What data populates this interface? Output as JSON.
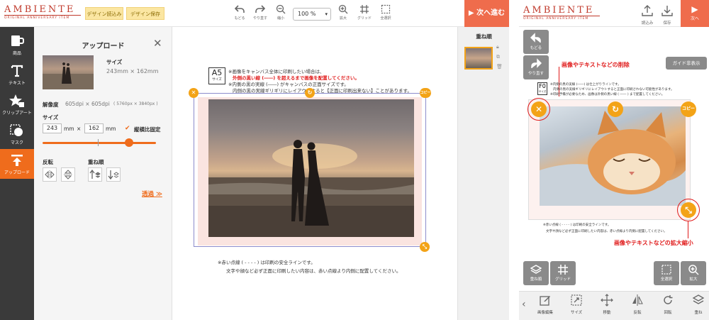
{
  "left": {
    "logo": {
      "main": "AMBIENTE",
      "sub": "ORIGINAL ANNIVERSARY ITEM"
    },
    "header_buttons": {
      "load": "デザイン読込み",
      "save": "デザイン保存"
    },
    "tools": [
      {
        "label": "もどる",
        "icon": "undo-icon"
      },
      {
        "label": "やり直す",
        "icon": "redo-icon"
      },
      {
        "label": "縮小",
        "icon": "zoom-out-icon"
      },
      {
        "label": "拡大",
        "icon": "zoom-in-icon"
      },
      {
        "label": "グリッド",
        "icon": "grid-icon"
      },
      {
        "label": "全選択",
        "icon": "select-all-icon"
      }
    ],
    "zoom": "100 %",
    "next": "▶ 次へ進む",
    "sidebar": [
      {
        "label": "商品",
        "icon": "mug-icon"
      },
      {
        "label": "テキスト",
        "icon": "text-icon"
      },
      {
        "label": "クリップアート",
        "icon": "clipart-star-icon"
      },
      {
        "label": "マスク",
        "icon": "mask-icon"
      },
      {
        "label": "アップロード",
        "icon": "upload-icon"
      }
    ],
    "panel": {
      "title": "アップロード",
      "size_label": "サイズ",
      "size_value": "243mm × 162mm",
      "res_label": "解像度",
      "res_value": "605dpi × 605dpi",
      "res_px": "( 5760px × 3840px )",
      "size_input_label": "サイズ",
      "width": "243",
      "height": "162",
      "unit": "mm",
      "times": "×",
      "keep_ratio": "縦横比固定",
      "flip_label": "反転",
      "layer_label": "重ね順",
      "transparent": "透過 ≫",
      "slider_value": 0.46
    },
    "canvas": {
      "size_code": "A5",
      "size_sub": "サイズ",
      "notes": [
        "※画像をキャンバス全体に印刷したい場合は、",
        "外側の黒い線 (――) を超えるまで画像を配置してください。",
        "※内側の黒の実線 (――) がキャンバスの正面サイズです。",
        "内側の黒の実線ギリギリにレイアウトすると【正面に印刷出来ない】ことがあります。"
      ],
      "copy": "コピー",
      "bottom_notes": [
        "※赤い点線 ( - - - - ) は印刷の安全ラインです。",
        "文字や顔など必ず正面に印刷したい内容は、赤い点線より内側に配置してください。"
      ]
    },
    "layers_title": "重ね順"
  },
  "right": {
    "logo": {
      "main": "AMBIENTE",
      "sub": "ORIGINAL ANNIVERSARY ITEM"
    },
    "header_tools": [
      {
        "label": "読込み",
        "icon": "upload-tray-icon"
      },
      {
        "label": "保存",
        "icon": "download-tray-icon"
      }
    ],
    "next": "次へ",
    "buttons": {
      "undo": "もどる",
      "redo": "やり直す",
      "guide": "ガイド非表示",
      "layer": "重ね順",
      "grid": "グリッド",
      "select_all": "全選択",
      "zoom": "拡大"
    },
    "annotations": {
      "delete": "画像やテキストなどの削除",
      "scale": "画像やテキストなどの拡大縮小"
    },
    "canvas": {
      "size_code": "F0",
      "size_sub": "サイズ",
      "copy": "コピー",
      "notes": [
        "※内側の黒の実線 (――) は仕上がりラインです。",
        "内側の黒の実線ギリギリにレイアウトすると正面に印刷されない可能性があります。",
        "※印刷予備が必要なため、画像は外側の黒い線 ( ―― ) まで配置してください。"
      ],
      "bottom_notes": [
        "※赤い点線 ( - - - - ) は印刷の安全ラインです。",
        "文字や顔など必ず正面に印刷したい内容は、赤い点線より内側に配置してください。"
      ]
    },
    "bottom_bar": [
      {
        "label": "画像編集",
        "icon": "edit-image-icon"
      },
      {
        "label": "サイズ",
        "icon": "resize-icon"
      },
      {
        "label": "移動",
        "icon": "move-icon"
      },
      {
        "label": "反転",
        "icon": "flip-icon"
      },
      {
        "label": "回転",
        "icon": "rotate-icon"
      },
      {
        "label": "重ね",
        "icon": "layer-icon"
      }
    ]
  }
}
